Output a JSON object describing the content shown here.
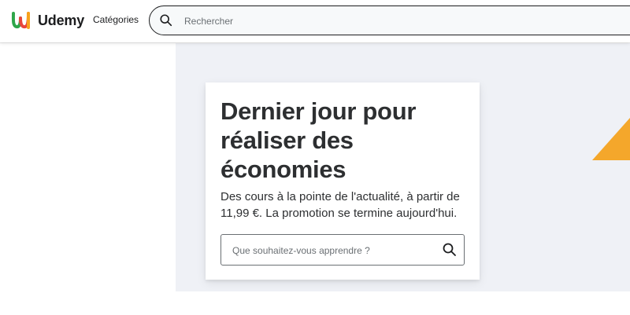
{
  "header": {
    "brand": "Udemy",
    "categories_label": "Catégories",
    "search": {
      "placeholder": "Rechercher",
      "value": ""
    }
  },
  "hero": {
    "title_lines": [
      "Dernier jour pour",
      "réaliser des",
      "économies"
    ],
    "text_lines": [
      "Des cours à la pointe de l'actualité, à partir de",
      "11,99 €. La promotion se termine aujourd'hui."
    ],
    "search": {
      "placeholder": "Que souhaitez-vous apprendre ?",
      "value": ""
    }
  },
  "icons": {
    "logo": "udemy-logo-icon",
    "header_search": "search-icon",
    "hero_search": "search-icon"
  },
  "colors": {
    "brand_text": "#1c1d1f",
    "hero_background": "#eff1f6",
    "accent_triangle": "#f4a72b",
    "logo_orange": "#f7a21b",
    "logo_green": "#2ea64a",
    "logo_red": "#e8453c"
  }
}
